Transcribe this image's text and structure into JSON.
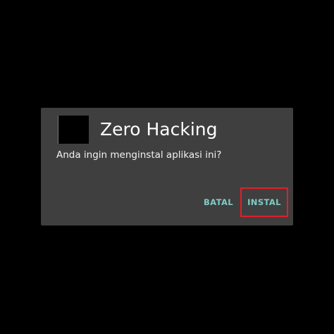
{
  "dialog": {
    "app_name": "Zero Hacking",
    "app_icon": "app-icon",
    "message": "Anda ingin menginstal aplikasi ini?",
    "buttons": {
      "cancel_label": "BATAL",
      "install_label": "INSTAL"
    },
    "highlight": {
      "target": "install",
      "color": "#e0202a"
    }
  },
  "colors": {
    "background": "#000000",
    "dialog": "#3f3f3f",
    "button_text": "#80cbc4",
    "title_text": "#ffffff"
  }
}
